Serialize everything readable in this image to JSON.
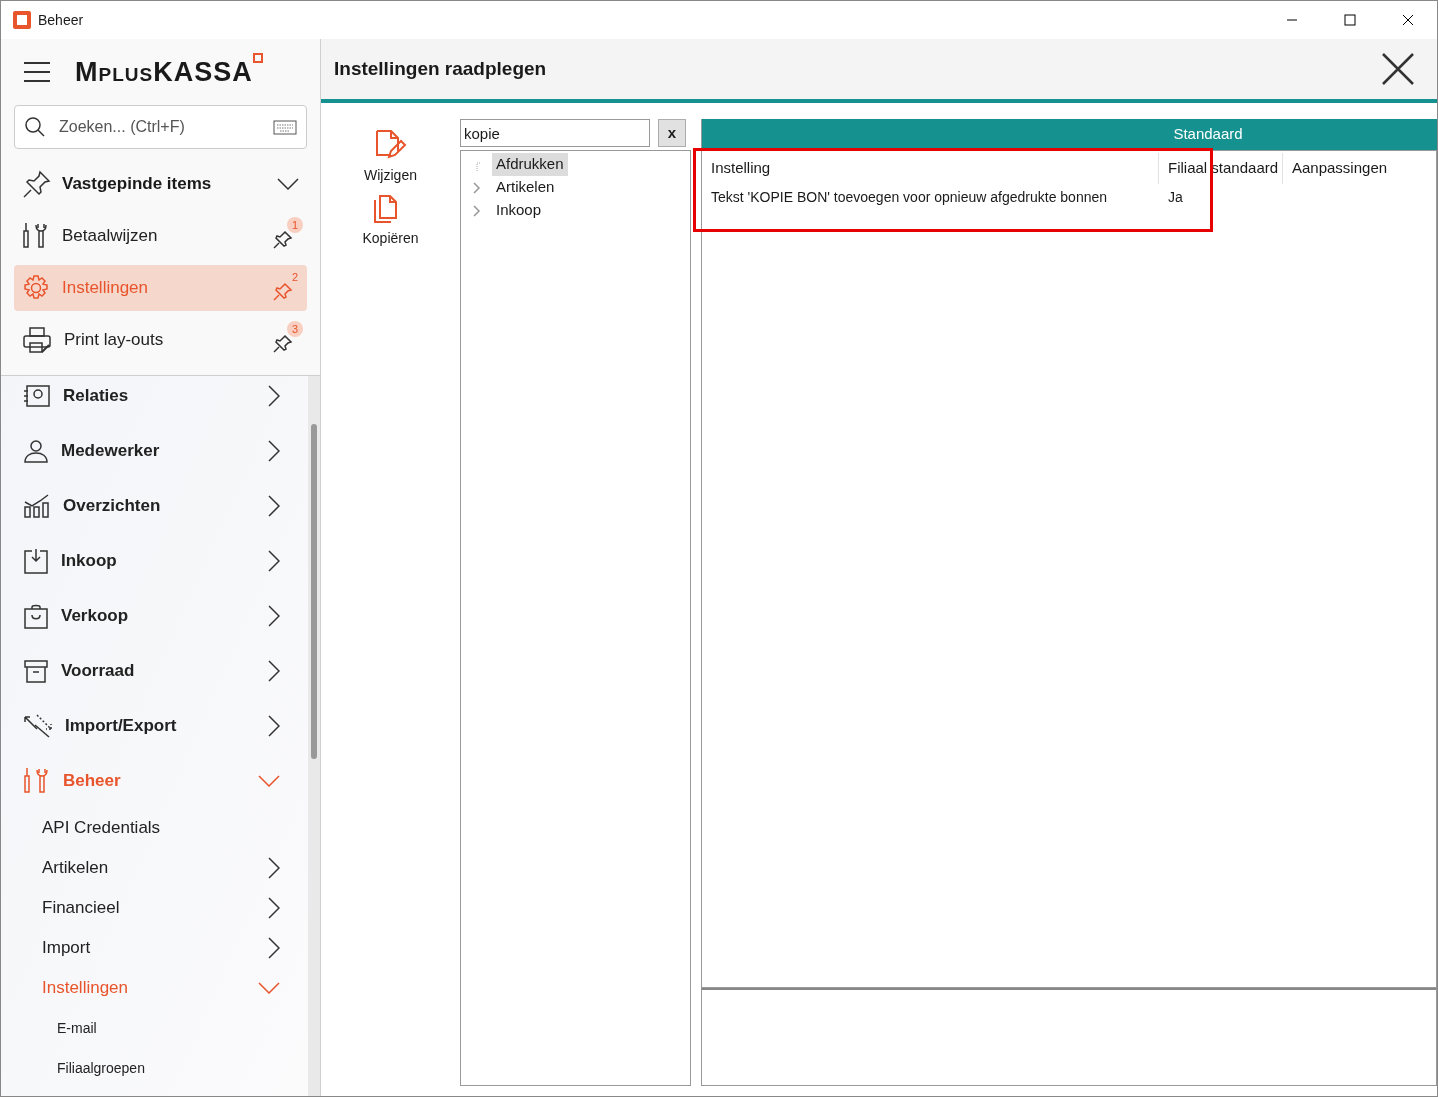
{
  "window": {
    "title": "Beheer"
  },
  "sidebar": {
    "logo": "MplusKASSA",
    "search": {
      "placeholder": "Zoeken... (Ctrl+F)"
    },
    "pinned": {
      "label": "Vastgepinde items",
      "expanded": true,
      "items": [
        {
          "label": "Betaalwijzen",
          "badge": "1",
          "selected": false
        },
        {
          "label": "Instellingen",
          "badge": "2",
          "selected": true
        },
        {
          "label": "Print lay-outs",
          "badge": "3",
          "selected": false
        }
      ]
    },
    "menu": [
      {
        "label": "Relaties",
        "expanded": false,
        "active": false
      },
      {
        "label": "Medewerker",
        "expanded": false,
        "active": false
      },
      {
        "label": "Overzichten",
        "expanded": false,
        "active": false
      },
      {
        "label": "Inkoop",
        "expanded": false,
        "active": false
      },
      {
        "label": "Verkoop",
        "expanded": false,
        "active": false
      },
      {
        "label": "Voorraad",
        "expanded": false,
        "active": false
      },
      {
        "label": "Import/Export",
        "expanded": false,
        "active": false
      },
      {
        "label": "Beheer",
        "expanded": true,
        "active": true,
        "children": [
          {
            "label": "API Credentials",
            "kind": "leaf",
            "active": false
          },
          {
            "label": "Artikelen",
            "kind": "folder",
            "expanded": false,
            "active": false
          },
          {
            "label": "Financieel",
            "kind": "folder",
            "expanded": false,
            "active": false
          },
          {
            "label": "Import",
            "kind": "folder",
            "expanded": false,
            "active": false
          },
          {
            "label": "Instellingen",
            "kind": "folder",
            "expanded": true,
            "active": true,
            "children": [
              {
                "label": "E-mail"
              },
              {
                "label": "Filiaalgroepen"
              }
            ]
          }
        ]
      }
    ]
  },
  "main": {
    "title": "Instellingen raadplegen",
    "actions": [
      {
        "label": "Wijzigen"
      },
      {
        "label": "Kopiëren"
      }
    ],
    "filter": {
      "value": "kopie",
      "clear": "x"
    },
    "tree": [
      {
        "label": "Afdrukken",
        "has_children": false,
        "selected": true
      },
      {
        "label": "Artikelen",
        "has_children": true,
        "selected": false
      },
      {
        "label": "Inkoop",
        "has_children": true,
        "selected": false
      }
    ],
    "grid": {
      "band": "Standaard",
      "columns": [
        "Instelling",
        "Filiaal standaard",
        "Aanpassingen"
      ],
      "rows": [
        {
          "instelling": "Tekst 'KOPIE BON' toevoegen voor opnieuw afgedrukte bonnen",
          "filiaal_standaard": "Ja"
        }
      ],
      "highlighted": true
    }
  }
}
